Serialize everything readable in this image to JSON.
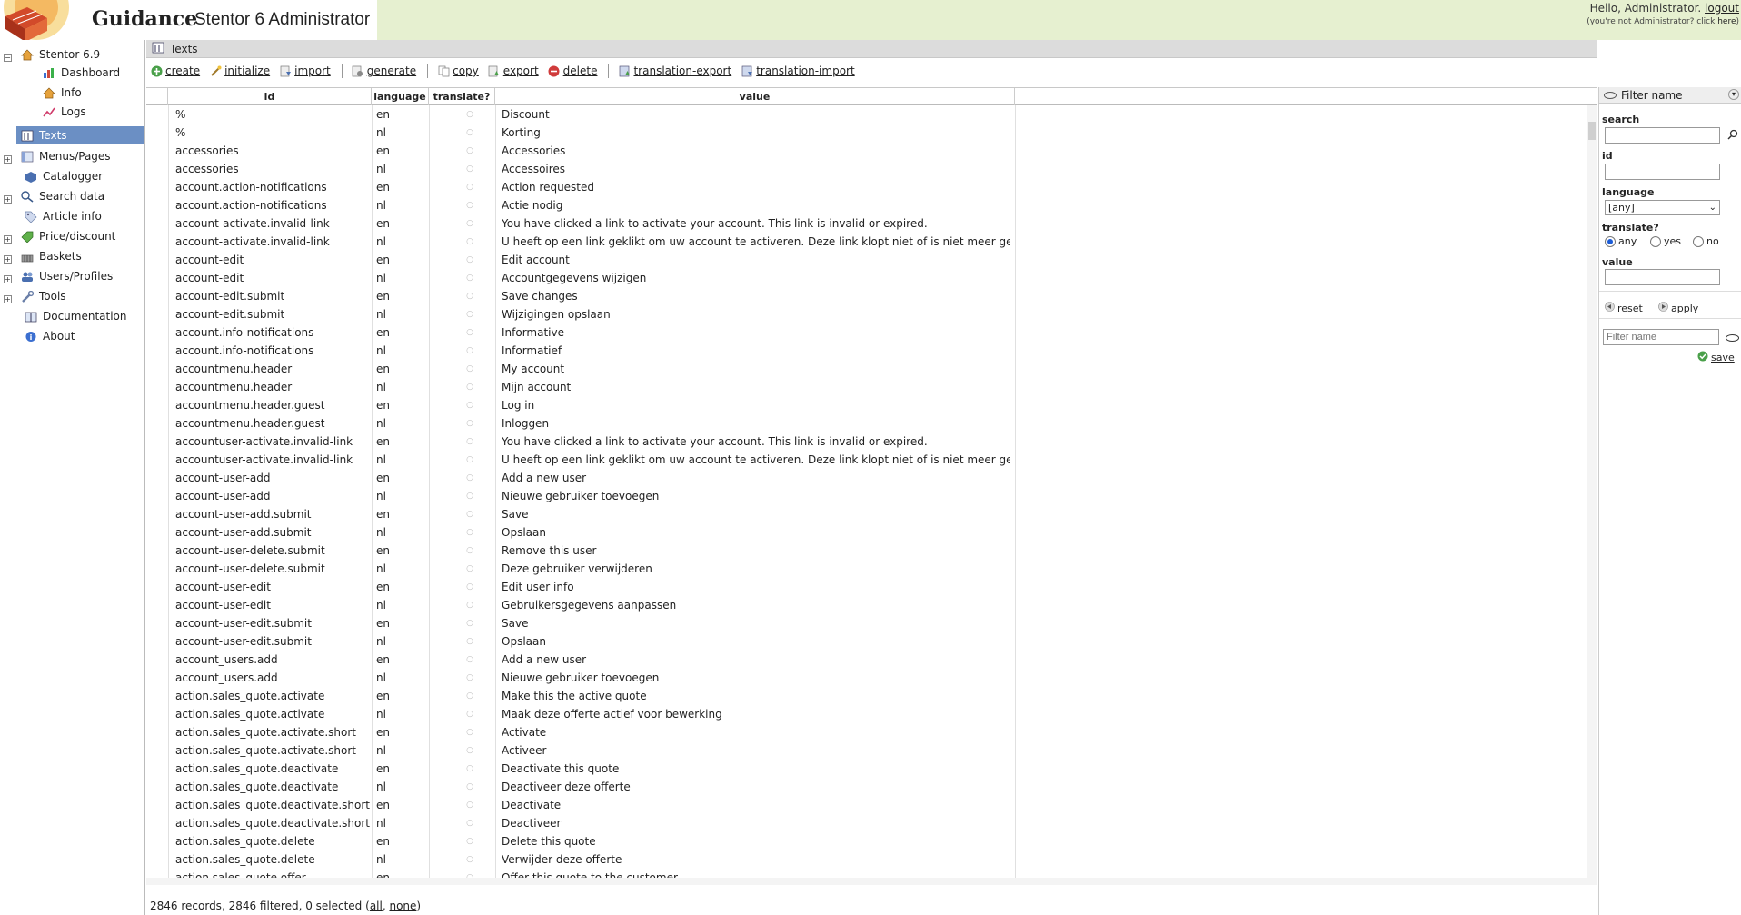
{
  "header": {
    "brand": "Guidance",
    "product": "Stentor 6 Administrator",
    "hello": "Hello, Administrator.",
    "logout": "logout",
    "not_admin": "(you're not Administrator? click",
    "here": "here",
    "close_paren": ")"
  },
  "sidebar": {
    "root": "Stentor 6.9",
    "items": [
      {
        "label": "Dashboard",
        "icon": "chart-icon"
      },
      {
        "label": "Info",
        "icon": "home-icon"
      },
      {
        "label": "Logs",
        "icon": "logs-icon"
      },
      {
        "label": "Texts",
        "icon": "texts-icon"
      },
      {
        "label": "Menus/Pages",
        "icon": "menus-icon"
      },
      {
        "label": "Catalogger",
        "icon": "catalogger-icon"
      },
      {
        "label": "Search data",
        "icon": "search-data-icon"
      },
      {
        "label": "Article info",
        "icon": "tag-icon"
      },
      {
        "label": "Price/discount",
        "icon": "price-icon"
      },
      {
        "label": "Baskets",
        "icon": "basket-icon"
      },
      {
        "label": "Users/Profiles",
        "icon": "users-icon"
      },
      {
        "label": "Tools",
        "icon": "tools-icon"
      },
      {
        "label": "Documentation",
        "icon": "docs-icon"
      },
      {
        "label": "About",
        "icon": "about-icon"
      }
    ]
  },
  "panel_title": "Texts",
  "toolbar": {
    "create": "create",
    "initialize": "initialize",
    "import": "import",
    "generate": "generate",
    "copy": "copy",
    "export": "export",
    "delete": "delete",
    "translation_export": "translation-export",
    "translation_import": "translation-import"
  },
  "columns": {
    "id": "id",
    "language": "language",
    "translate": "translate?",
    "value": "value"
  },
  "rows": [
    [
      "%",
      "en",
      "Discount"
    ],
    [
      "%",
      "nl",
      "Korting"
    ],
    [
      "accessories",
      "en",
      "Accessories"
    ],
    [
      "accessories",
      "nl",
      "Accessoires"
    ],
    [
      "account.action-notifications",
      "en",
      "Action requested"
    ],
    [
      "account.action-notifications",
      "nl",
      "Actie nodig"
    ],
    [
      "account-activate.invalid-link",
      "en",
      "You have clicked a link to activate your account. This link is invalid or expired."
    ],
    [
      "account-activate.invalid-link",
      "nl",
      "U heeft op een link geklikt om uw account te activeren. Deze link klopt niet of is niet meer geldig."
    ],
    [
      "account-edit",
      "en",
      "Edit account"
    ],
    [
      "account-edit",
      "nl",
      "Accountgegevens wijzigen"
    ],
    [
      "account-edit.submit",
      "en",
      "Save changes"
    ],
    [
      "account-edit.submit",
      "nl",
      "Wijzigingen opslaan"
    ],
    [
      "account.info-notifications",
      "en",
      "Informative"
    ],
    [
      "account.info-notifications",
      "nl",
      "Informatief"
    ],
    [
      "accountmenu.header",
      "en",
      "My account"
    ],
    [
      "accountmenu.header",
      "nl",
      "Mijn account"
    ],
    [
      "accountmenu.header.guest",
      "en",
      "Log in"
    ],
    [
      "accountmenu.header.guest",
      "nl",
      "Inloggen"
    ],
    [
      "accountuser-activate.invalid-link",
      "en",
      "You have clicked a link to activate your account. This link is invalid or expired."
    ],
    [
      "accountuser-activate.invalid-link",
      "nl",
      "U heeft op een link geklikt om uw account te activeren. Deze link klopt niet of is niet meer geldig."
    ],
    [
      "account-user-add",
      "en",
      "Add a new user"
    ],
    [
      "account-user-add",
      "nl",
      "Nieuwe gebruiker toevoegen"
    ],
    [
      "account-user-add.submit",
      "en",
      "Save"
    ],
    [
      "account-user-add.submit",
      "nl",
      "Opslaan"
    ],
    [
      "account-user-delete.submit",
      "en",
      "Remove this user"
    ],
    [
      "account-user-delete.submit",
      "nl",
      "Deze gebruiker verwijderen"
    ],
    [
      "account-user-edit",
      "en",
      "Edit user info"
    ],
    [
      "account-user-edit",
      "nl",
      "Gebruikersgegevens aanpassen"
    ],
    [
      "account-user-edit.submit",
      "en",
      "Save"
    ],
    [
      "account-user-edit.submit",
      "nl",
      "Opslaan"
    ],
    [
      "account_users.add",
      "en",
      "Add a new user"
    ],
    [
      "account_users.add",
      "nl",
      "Nieuwe gebruiker toevoegen"
    ],
    [
      "action.sales_quote.activate",
      "en",
      "Make this the active quote"
    ],
    [
      "action.sales_quote.activate",
      "nl",
      "Maak deze offerte actief voor bewerking"
    ],
    [
      "action.sales_quote.activate.short",
      "en",
      "Activate"
    ],
    [
      "action.sales_quote.activate.short",
      "nl",
      "Activeer"
    ],
    [
      "action.sales_quote.deactivate",
      "en",
      "Deactivate this quote"
    ],
    [
      "action.sales_quote.deactivate",
      "nl",
      "Deactiveer deze offerte"
    ],
    [
      "action.sales_quote.deactivate.short",
      "en",
      "Deactivate"
    ],
    [
      "action.sales_quote.deactivate.short",
      "nl",
      "Deactiveer"
    ],
    [
      "action.sales_quote.delete",
      "en",
      "Delete this quote"
    ],
    [
      "action.sales_quote.delete",
      "nl",
      "Verwijder deze offerte"
    ],
    [
      "action.sales_quote.offer",
      "en",
      "Offer this quote to the customer"
    ]
  ],
  "translate_marker": "○",
  "status": {
    "text": "2846 records, 2846 filtered, 0 selected (",
    "all": "all",
    "sep": ", ",
    "none": "none",
    "close": ")"
  },
  "filter": {
    "title": "Filter name",
    "search_label": "search",
    "id_label": "id",
    "language_label": "language",
    "language_value": "[any]",
    "translate_label": "translate?",
    "opt_any": "any",
    "opt_yes": "yes",
    "opt_no": "no",
    "value_label": "value",
    "reset": "reset",
    "apply": "apply",
    "filter_name_placeholder": "Filter name",
    "save": "save"
  },
  "colors": {
    "active_nav": "#6b8fc4",
    "header_bg": "#e6f0d0"
  }
}
